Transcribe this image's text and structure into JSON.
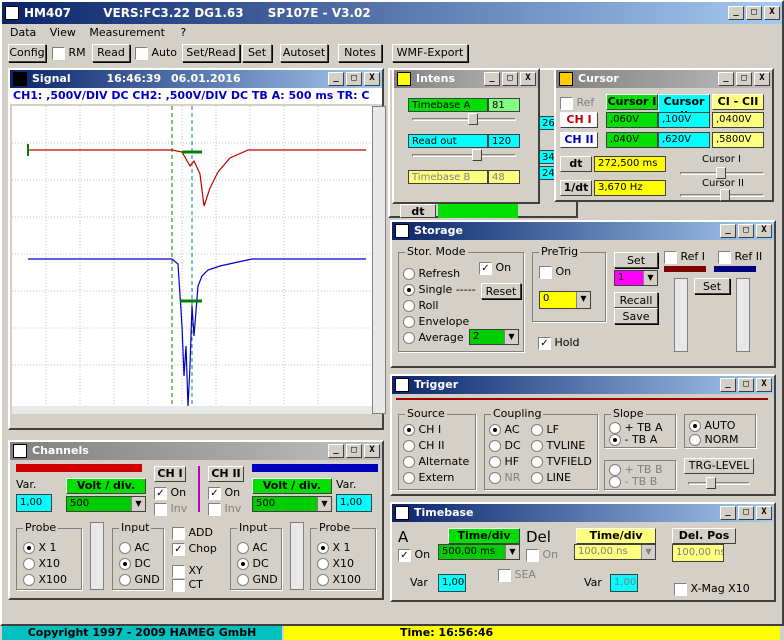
{
  "app": {
    "title": "HM407",
    "title_info": "VERS:FC3.22 DG1.63",
    "model": "SP107E - V3.02"
  },
  "menu": [
    "Data",
    "View",
    "Measurement",
    "?"
  ],
  "toolbar": {
    "config": "Config",
    "rm": "RM",
    "read": "Read",
    "auto": "Auto",
    "setread": "Set/Read",
    "set": "Set",
    "autoset": "Autoset",
    "notes": "Notes",
    "wmf": "WMF-Export"
  },
  "signal": {
    "title": "Signal",
    "time": "16:46:39",
    "date": "06.01.2016",
    "status": "CH1: ,500V/DIV DC  CH2: ,500V/DIV DC   TB A: 500 ms   TR: C"
  },
  "intens": {
    "title": "Intens",
    "timebase_a": "Timebase A",
    "timebase_a_val": "81",
    "readout": "Read out",
    "readout_val": "120",
    "timebase_b": "Timebase B",
    "timebase_b_val": "48",
    "behind": [
      "26",
      "34",
      "24"
    ],
    "dt": "dt"
  },
  "cursor": {
    "title": "Cursor",
    "ref": "Ref",
    "cursor1": "Cursor I",
    "cursor2": "Cursor II",
    "diff": "CI - CII",
    "ch1": "CH I",
    "ch1_c1": ",060V",
    "ch1_c2": ",100V",
    "ch1_d": ",0400V",
    "ch2": "CH II",
    "ch2_c1": ",040V",
    "ch2_c2": ",620V",
    "ch2_d": ",5800V",
    "dt": "dt",
    "dt_val": "272,500 ms",
    "inv_dt": "1/dt",
    "inv_dt_val": "3,670 Hz",
    "cursor_i": "Cursor I",
    "cursor_ii": "Cursor II"
  },
  "storage": {
    "title": "Storage",
    "stor_mode": "Stor. Mode",
    "refresh": "Refresh",
    "single": "Single -----",
    "roll": "Roll",
    "envelope": "Envelope",
    "average": "Average",
    "avg_val": "2",
    "on": "On",
    "reset": "Reset",
    "pretrig": "PreTrig",
    "pretrig_on": "On",
    "pretrig_val": "0",
    "set": "Set",
    "set_val": "1",
    "recall": "Recall",
    "save": "Save",
    "ref1": "Ref I",
    "ref2": "Ref II",
    "set2": "Set",
    "hold": "Hold"
  },
  "trigger": {
    "title": "Trigger",
    "source": "Source",
    "ch1": "CH I",
    "ch2": "CH II",
    "alternate": "Alternate",
    "extern": "Extern",
    "coupling": "Coupling",
    "ac": "AC",
    "dc": "DC",
    "hf": "HF",
    "nr": "NR",
    "lf": "LF",
    "tvline": "TVLINE",
    "tvfield": "TVFIELD",
    "line": "LINE",
    "slope": "Slope",
    "tba_pos": "+ TB A",
    "tba_neg": "- TB A",
    "tbb_pos": "+ TB B",
    "tbb_neg": "- TB B",
    "auto": "AUTO",
    "norm": "NORM",
    "level": "TRG-LEVEL"
  },
  "channels": {
    "title": "Channels",
    "var": "Var.",
    "var1_val": "1,00",
    "volt_div": "Volt / div.",
    "volt1_val": "500",
    "ch1": "CH I",
    "on1": "On",
    "inv1": "Inv",
    "ch2": "CH II",
    "on2": "On",
    "inv2": "Inv",
    "volt2_val": "500",
    "var2_val": "1,00",
    "probe": "Probe",
    "x1": "X 1",
    "x10": "X10",
    "x100": "X100",
    "input": "Input",
    "ac": "AC",
    "dc": "DC",
    "gnd": "GND",
    "add": "ADD",
    "chop": "Chop",
    "xy": "XY",
    "ct": "CT"
  },
  "timebase": {
    "title": "Timebase",
    "a": "A",
    "on": "On",
    "time_div": "Time/div",
    "a_val": "500,00 ms",
    "var": "Var",
    "var_val": "1,00",
    "del": "Del",
    "del_on": "On",
    "del_time_div": "Time/div",
    "del_val": "100,00 ns",
    "sea": "SEA",
    "del_var": "Var",
    "del_var_val": "1,00",
    "del_pos": "Del. Pos",
    "del_pos_val": "100,00 ns",
    "xmag": "X-Mag X10"
  },
  "status": {
    "copyright": "Copyright 1997 - 2009 HAMEG GmbH",
    "time": "Time: 16:56:46"
  },
  "colors": {
    "ch1": "#d00000",
    "ch2": "#0000c0",
    "accent": "#00ffff",
    "field_yellow": "#ffff00",
    "field_green": "#00e000"
  }
}
